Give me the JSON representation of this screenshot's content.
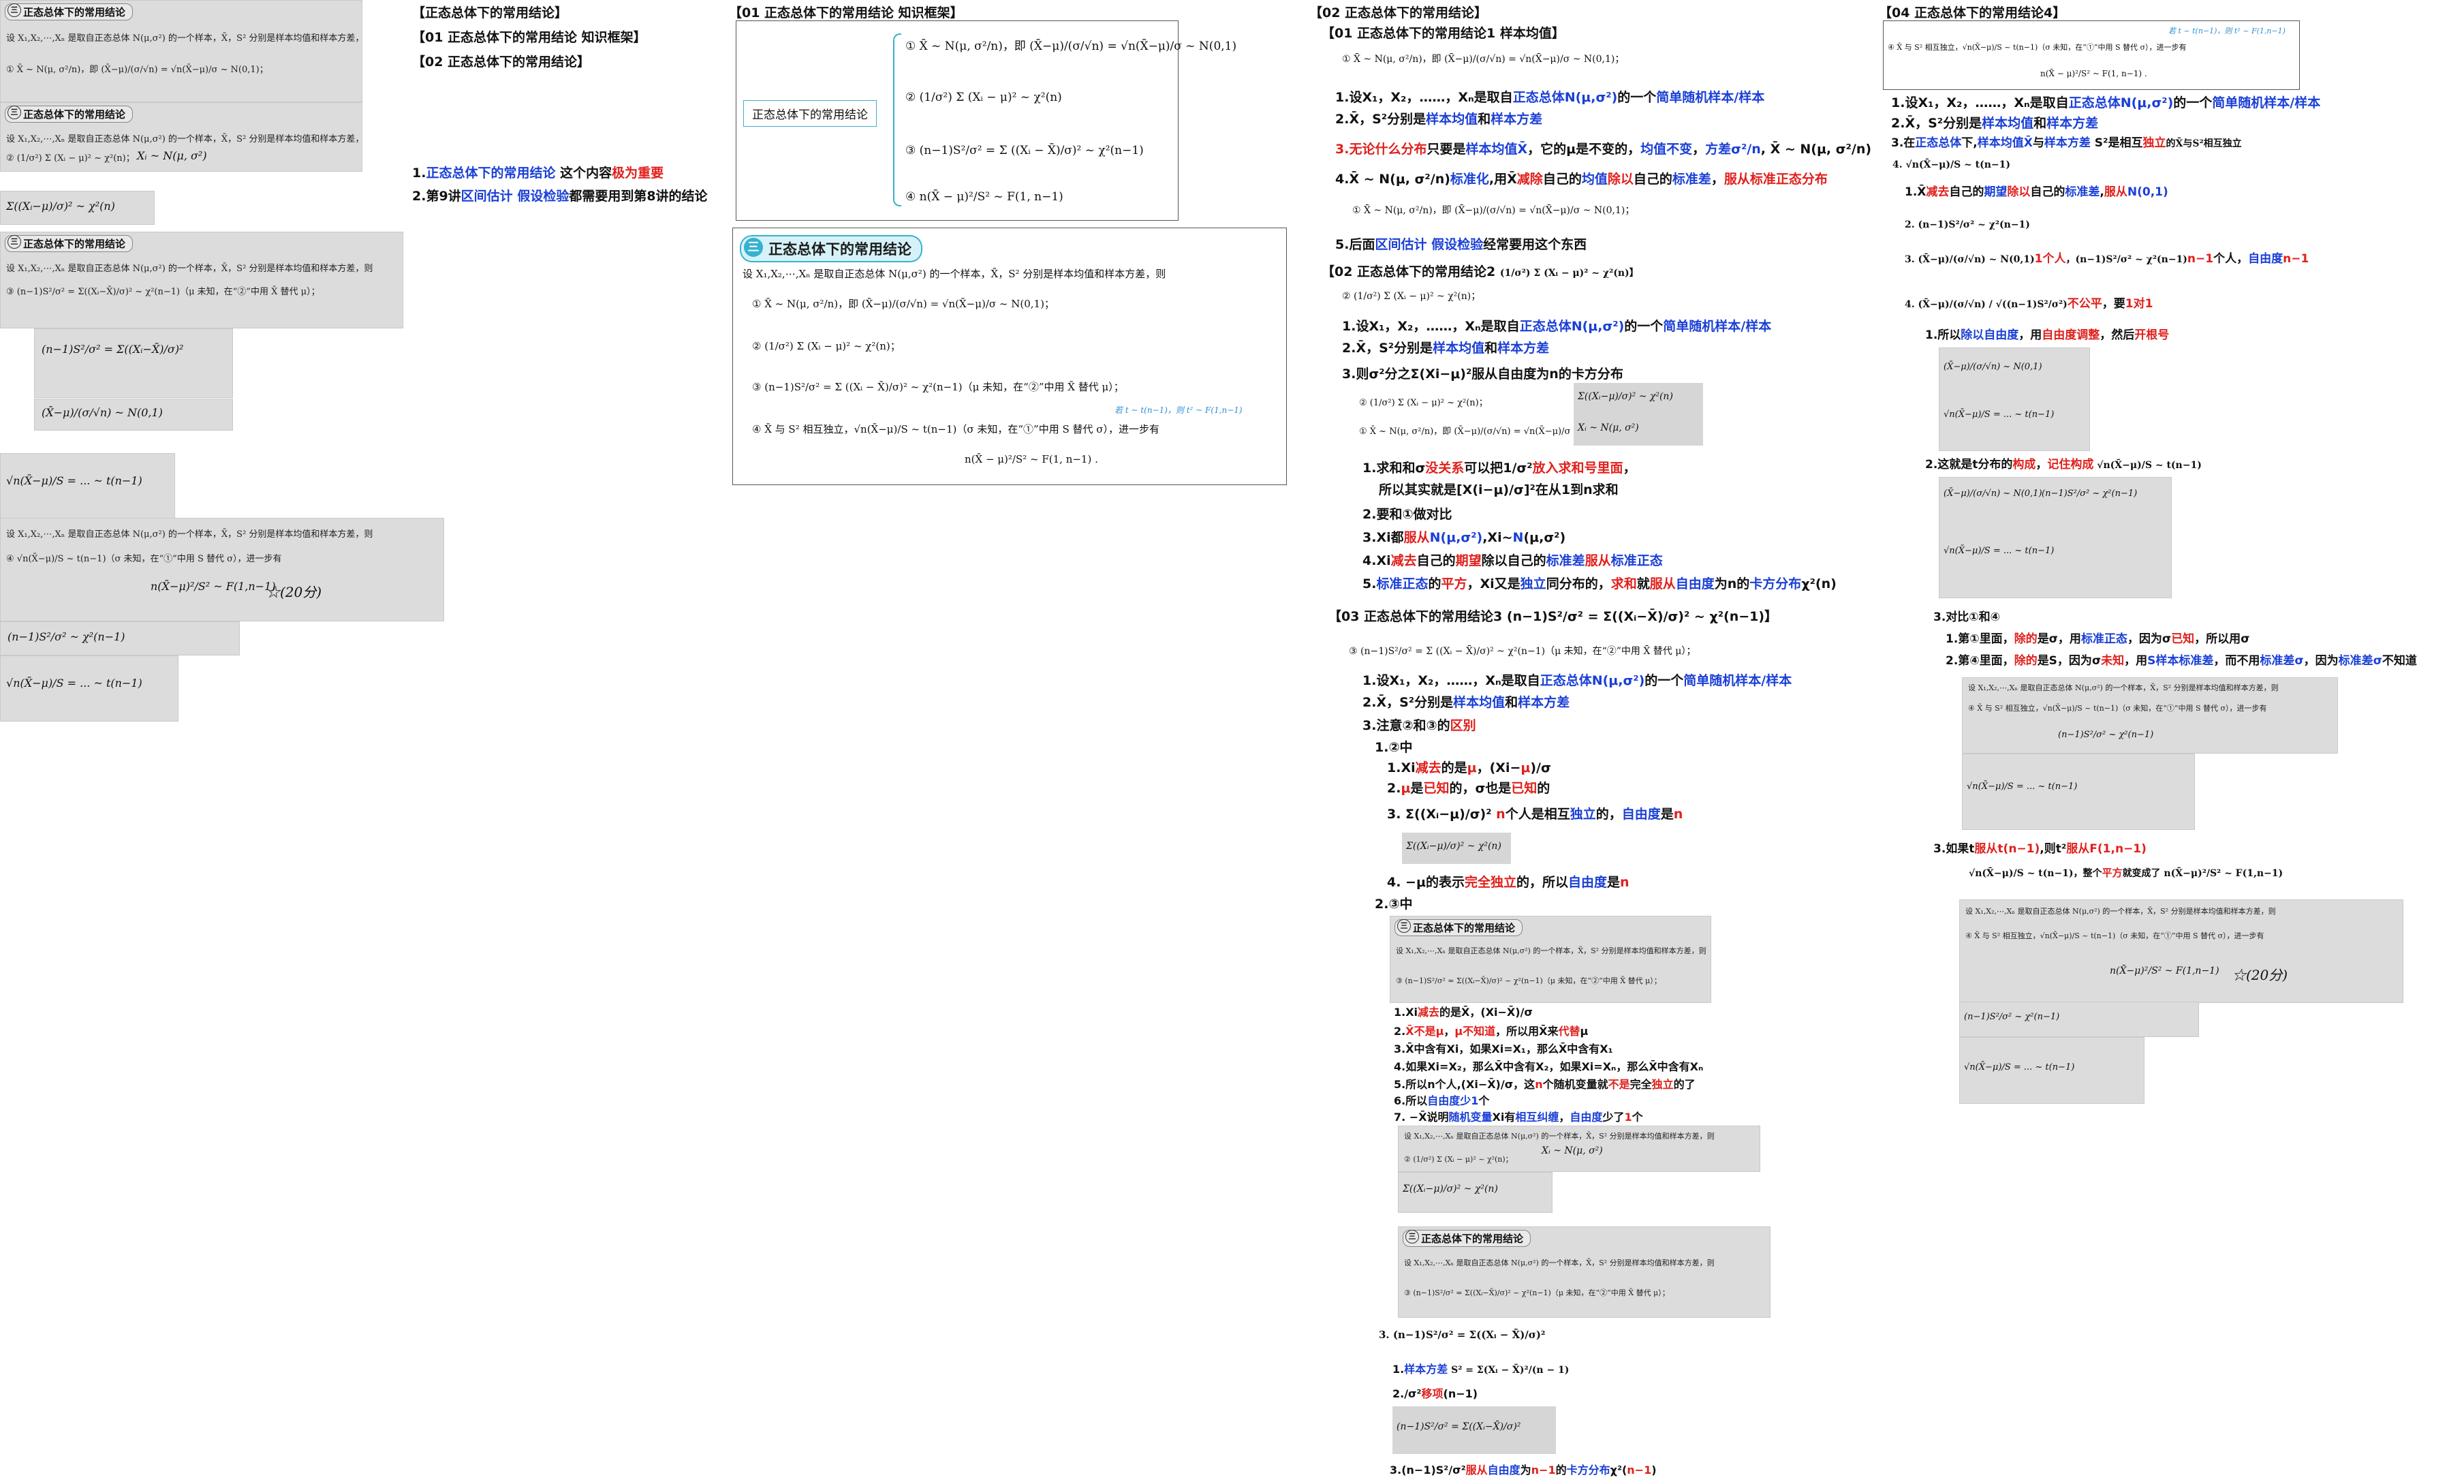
{
  "col1": {
    "header": "【正态总体下的常用结论】",
    "sub1": "【01 正态总体下的常用结论 知识框架】",
    "sub2": "【02 正态总体下的常用结论】",
    "note1_a": "1.",
    "note1_b": "正态总体下的常用结论",
    "note1_c": " 这个内容",
    "note1_d": "极为重要",
    "note2_a": "2.第9讲",
    "note2_b": "区间估计",
    "note2_c": " ",
    "note2_d": "假设检验",
    "note2_e": "都需要用到第8讲的结论"
  },
  "scan_title": "正态总体下的常用结论",
  "frame_col": {
    "header": "【01 正态总体下的常用结论 知识框架】",
    "label": "正态总体下的常用结论",
    "items": [
      "① X̄ ~ N(μ, σ²/n)，即 (X̄−μ)/(σ/√n) = √n(X̄−μ)/σ ~ N(0,1)",
      "② (1/σ²) Σ (Xᵢ − μ)² ~ χ²(n)",
      "③ (n−1)S²/σ² = Σ ((Xᵢ − X̄)/σ)² ~ χ²(n−1)",
      "④ n(X̄ − μ)²/S² ~ F(1, n−1)"
    ],
    "badge_num": "三",
    "badge_text": "正态总体下的常用结论",
    "intro": "设 X₁,X₂,⋯,Xₙ 是取自正态总体 N(μ,σ²) 的一个样本，X̄，S² 分别是样本均值和样本方差，则",
    "r1": "① X̄ ~ N(μ, σ²/n)，即 (X̄−μ)/(σ/√n) = √n(X̄−μ)/σ ~ N(0,1)；",
    "r2": "② (1/σ²) Σ (Xᵢ − μ)² ~ χ²(n)；",
    "r3": "③ (n−1)S²/σ² = Σ ((Xᵢ − X̄)/σ)² ~ χ²(n−1)（μ 未知，在“②”中用 X̄ 替代 μ）；",
    "r4": "④ X̄ 与 S² 相互独立，√n(X̄−μ)/S ~ t(n−1)（σ 未知，在“①”中用 S 替代 σ），进一步有",
    "r4b": "n(X̄ − μ)²/S² ~ F(1, n−1) .",
    "annot": "若 t ~ t(n−1)，则 t² ~ F(1,n−1)"
  },
  "col3": {
    "header": "【02 正态总体下的常用结论】",
    "s1": "【01 正态总体下的常用结论1 样本均值】",
    "s1f": "① X̄ ~ N(μ, σ²/n)，即 (X̄−μ)/(σ/√n) = √n(X̄−μ)/σ ~ N(0,1)；",
    "l1a": "1.设X₁，X₂，……，Xₙ是取自",
    "l1b": "正态总体N(μ,σ²)",
    "l1c": "的一个",
    "l1d": "简单随机样本/样本",
    "l2a": "2.X̄，S²分别是",
    "l2b": "样本均值",
    "l2c": "和",
    "l2d": "样本方差",
    "l3a": "3.无论什么分布",
    "l3b": "只要是",
    "l3c": "样本均值X̄",
    "l3d": "，它的μ是不变的，",
    "l3e": "均值不变",
    "l3f": "，",
    "l3g": "方差σ²/n",
    "l3h": ", X̄ ~ N(μ, σ²/n)",
    "l4a": "4.X̄ ~ N(μ, σ²/n)",
    "l4b": "标准化",
    "l4c": ",用X̄",
    "l4d": "减除",
    "l4e": "自己的",
    "l4f": "均值",
    "l4g": "除以",
    "l4h": "自己的",
    "l4i": "标准差",
    "l4j": "，",
    "l4k": "服从标准正态分布",
    "l4f2": "① X̄ ~ N(μ, σ²/n)，即 (X̄−μ)/(σ/√n) = √n(X̄−μ)/σ ~ N(0,1)；",
    "l5a": "5.后面",
    "l5b": "区间估计",
    "l5c": " ",
    "l5d": "假设检验",
    "l5e": "经常要用这个东西",
    "s2": "【02 正态总体下的常用结论2",
    "s2f": "(1/σ²) Σ (Xᵢ − μ)² ~ χ²(n)】",
    "s2f2": "② (1/σ²) Σ (Xᵢ − μ)² ~ χ²(n)；",
    "m1a": "1.设X₁，X₂，……，Xₙ是取自",
    "m1b": "正态总体N(μ,σ²)",
    "m1c": "的一个",
    "m1d": "简单随机样本/样本",
    "m2a": "2.X̄，S²分别是",
    "m2b": "样本均值",
    "m2c": "和",
    "m2d": "样本方差",
    "m3": "3.则σ²分之Σ(Xi−μ)²服从自由度为n的卡方分布",
    "m3f1": "② (1/σ²) Σ (Xᵢ − μ)² ~ χ²(n)；",
    "m3f2": "① X̄ ~ N(μ, σ²/n)，即 (X̄−μ)/(σ/√n) = √n(X̄−μ)/σ ~ N(0,1)；",
    "hw1": "Σ((Xᵢ−μ)/σ)² ~ χ²(n)",
    "hw2": "Xᵢ ~ N(μ, σ²)",
    "n1a": "1.求和和σ",
    "n1b": "没关系",
    "n1c": "可以把1/σ²",
    "n1d": "放入求和号里面",
    "n1e": "，",
    "n1f": "所以其实就是[X(i−μ)/σ]²在从1到n求和",
    "n2": "2.要和①做对比",
    "n3a": "3.Xi都",
    "n3b": "服从",
    "n3c": "N(μ,σ²)",
    "n3d": ",Xi~",
    "n3e": "N",
    "n3f": "(μ,σ²)",
    "n4a": "4.Xi",
    "n4b": "减去",
    "n4c": "自己的",
    "n4d": "期望",
    "n4e": "除以自己的",
    "n4f": "标准差",
    "n4g": "服从",
    "n4h": "标准正态",
    "n5a": "5.",
    "n5b": "标准正态",
    "n5c": "的",
    "n5d": "平方",
    "n5e": "，Xi又是",
    "n5f": "独立",
    "n5g": "同分布的，",
    "n5h": "求和",
    "n5i": "就",
    "n5j": "服从",
    "n5k": "自由度",
    "n5l": "为n的",
    "n5m": "卡方分布",
    "n5n": "χ²(n)",
    "s3": "【03 正态总体下的常用结论3 (n−1)S²/σ² = Σ((Xᵢ−X̄)/σ)² ~ χ²(n−1)】",
    "s3f": "③ (n−1)S²/σ² = Σ ((Xᵢ − X̄)/σ)² ~ χ²(n−1)（μ 未知，在“②”中用 X̄ 替代 μ）；",
    "p1a": "1.设X₁，X₂，……，Xₙ是取自",
    "p1b": "正态总体N(μ,σ²)",
    "p1c": "的一个",
    "p1d": "简单随机样本/样本",
    "p2a": "2.X̄，S²分别是",
    "p2b": "样本均值",
    "p2c": "和",
    "p2d": "样本方差",
    "p3a": "3.注意②和③的",
    "p3b": "区别",
    "q0": "1.②中",
    "q1a": "1.Xi",
    "q1b": "减去",
    "q1c": "的是",
    "q1d": "μ",
    "q1e": "，(Xi−",
    "q1f": "μ",
    "q1g": ")/σ",
    "q2a": "2.",
    "q2b": "μ",
    "q2c": "是",
    "q2d": "已知",
    "q2e": "的，σ也是",
    "q2f": "已知",
    "q2g": "的",
    "q3a": "3. Σ((Xᵢ−μ)/σ)² ",
    "q3b": "n",
    "q3c": "个人是相互",
    "q3d": "独立",
    "q3e": "的，",
    "q3f": "自由度",
    "q3g": "是",
    "q3h": "n",
    "q3hw": "Σ((Xᵢ−μ)/σ)² ~ χ²(n)",
    "q4a": "4. −μ的表示",
    "q4b": "完全独立",
    "q4c": "的，所以",
    "q4d": "自由度",
    "q4e": "是",
    "q4f": "n",
    "r0": "2.③中",
    "sc1l1": "设 X₁,X₂,⋯,Xₙ 是取自正态总体 N(μ,σ²) 的一个样本，X̄，S² 分别是样本均值和样本方差，则",
    "sc1l2": "③ (n−1)S²/σ² = Σ((Xᵢ−X̄)/σ)² ~ χ²(n−1)（μ 未知，在“②”中用 X̄ 替代 μ）；",
    "t1a": "1.Xi",
    "t1b": "减去",
    "t1c": "的是X̄，(Xi−X̄)/σ",
    "t2a": "2.",
    "t2b": "X̄",
    "t2c": "不是μ",
    "t2d": "，",
    "t2e": "μ不知道",
    "t2f": "，所以用X̄来",
    "t2g": "代替",
    "t2h": "μ",
    "t3": "3.X̄中含有Xi，如果Xi=X₁，那么X̄中含有X₁",
    "t4": "4.如果Xi=X₂，那么X̄中含有X₂，如果Xi=Xₙ，那么X̄中含有Xₙ",
    "t5a": "5.所以n个人,(Xi−X̄)/σ，这",
    "t5b": "n",
    "t5c": "个随机变量就",
    "t5d": "不是",
    "t5e": "完全",
    "t5f": "独立",
    "t5g": "的了",
    "t6a": "6.所以",
    "t6b": "自由度少1",
    "t6c": "个",
    "t7a": "7. −X̄说明",
    "t7b": "随机变量",
    "t7c": "Xi有",
    "t7d": "相互纠缠",
    "t7e": "，",
    "t7f": "自由度",
    "t7g": "少了",
    "t7h": "1",
    "t7i": "个",
    "sc2l1": "设 X₁,X₂,⋯,Xₙ 是取自正态总体 N(μ,σ²) 的一个样本，X̄，S² 分别是样本均值和样本方差，则",
    "sc2l2": "② (1/σ²) Σ (Xᵢ − μ)² ~ χ²(n)；",
    "sc2hw1": "Xᵢ ~ N(μ, σ²)",
    "sc2hw2": "Σ((Xᵢ−μ)/σ)² ~ χ²(n)",
    "sc3l1": "设 X₁,X₂,⋯,Xₙ 是取自正态总体 N(μ,σ²) 的一个样本，X̄，S² 分别是样本均值和样本方差，则",
    "sc3l2": "③ (n−1)S²/σ² = Σ((Xᵢ−X̄)/σ)² ~ χ²(n−1)（μ 未知，在“②”中用 X̄ 替代 μ）；",
    "u3": "3. (n−1)S²/σ² = Σ((Xᵢ − X̄)/σ)²",
    "v1a": "1.",
    "v1b": "样本方差",
    "v1c": " S² = Σ(Xᵢ − X̄)²/(n − 1)",
    "v2a": "2./σ²",
    "v2b": "移项",
    "v2c": "(n−1)",
    "v2hw": "(n−1)S²/σ² = Σ((Xᵢ−X̄)/σ)²",
    "w3a": "3.(n−1)S²/σ²",
    "w3b": "服从",
    "w3c": "自由度",
    "w3d": "为",
    "w3e": "n−1",
    "w3f": "的",
    "w3g": "卡方分布",
    "w3h": "χ²(",
    "w3i": "n−1",
    "w3j": ")"
  },
  "col4": {
    "header": "【04 正态总体下的常用结论4】",
    "box1": "④ X̄ 与 S² 相互独立，√n(X̄−μ)/S ~ t(n−1)（σ 未知，在“①”中用 S 替代 σ），进一步有",
    "box2": "n(X̄ − μ)²/S² ~ F(1, n−1) .",
    "box_annot": "若 t ~ t(n−1)，则 t² ~ F(1,n−1)",
    "a1a": "1.设X₁，X₂，……，Xₙ是取自",
    "a1b": "正态总体N(μ,σ²)",
    "a1c": "的一个",
    "a1d": "简单随机样本/样本",
    "a2a": "2.X̄，S²分别是",
    "a2b": "样本均值",
    "a2c": "和",
    "a2d": "样本方差",
    "a3a": "3.在",
    "a3b": "正态总体",
    "a3c": "下,",
    "a3d": "样本均值X̄",
    "a3e": "与",
    "a3f": "样本方差",
    "a3g": " S²是相互",
    "a3h": "独立",
    "a3i": "的X̄与S²相互独立",
    "a4": "4. √n(X̄−μ)/S ~ t(n−1)",
    "b1a": "1.X̄",
    "b1b": "减去",
    "b1c": "自己的",
    "b1d": "期望",
    "b1e": "除以",
    "b1f": "自己的",
    "b1g": "标准差",
    "b1h": ",",
    "b1i": "服从",
    "b1j": "N(0,1)",
    "b2": "2. (n−1)S²/σ² ~ χ²(n−1)",
    "b3a": "3. (X̄−μ)/(σ/√n) ~ N(0,1)",
    "b3b": "1个人",
    "b3c": "，(n−1)S²/σ² ~ χ²(n−1)",
    "b3d": "n−1",
    "b3e": "个人，",
    "b3f": "自由度",
    "b3g": "n−1",
    "b4a": "4. (X̄−μ)/(σ/√n) / √((n−1)S²/σ²)",
    "b4b": "不公平",
    "b4c": "，要",
    "b4d": "1对1",
    "c1a": "1.所以",
    "c1b": "除以自由度",
    "c1c": "，用",
    "c1d": "自由度调整",
    "c1e": "，然后",
    "c1f": "开根号",
    "c2a": "2.这就是t分布的",
    "c2b": "构成",
    "c2c": "，",
    "c2d": "记住构成",
    "c2e": "  √n(X̄−μ)/S ~ t(n−1)",
    "d3": "3.对比①和④",
    "e1a": "1.第①里面，",
    "e1b": "除的",
    "e1c": "是σ，用",
    "e1d": "标准正态",
    "e1e": "，因为σ",
    "e1f": "已知",
    "e1g": "，所以用σ",
    "e2a": "2.第④里面，",
    "e2b": "除的",
    "e2c": "是S，因为σ",
    "e2d": "未知",
    "e2e": "，用",
    "e2f": "S样本标准差",
    "e2g": "，而不用",
    "e2h": "标准差σ",
    "e2i": "，因为",
    "e2j": "标准差σ",
    "e2k": "不知道",
    "f3a": "3.如果t",
    "f3b": "服从t(n−1)",
    "f3c": ",则t²",
    "f3d": "服从F(1,n−1)",
    "f3e": "√n(X̄−μ)/S ~ t(n−1)，整个",
    "f3f": "平方",
    "f3g": "就变成了 n(X̄−μ)²/S² ~ F(1,n−1)",
    "sc_l1": "设 X₁,X₂,⋯,Xₙ 是取自正态总体 N(μ,σ²) 的一个样本，X̄，S² 分别是样本均值和样本方差，则",
    "sc_l2": "④ X̄ 与 S² 相互独立，√n(X̄−μ)/S ~ t(n−1)（σ 未知，在“①”中用 S 替代 σ），进一步有",
    "sc_l3": "n(X̄−μ)²/S² ~ F(1,n−1)",
    "hw_a": "(X̄−μ)/(σ/√n) ~ N(0,1)",
    "hw_b": "(n−1)S²/σ² ~ χ²(n−1)",
    "hw_c": "√n(X̄−μ)/S = ... ~ t(n−1)",
    "hw_star": "☆(20分)"
  },
  "left_scans": {
    "t1": "设 X₁,X₂,⋯,Xₙ 是取自正态总体 N(μ,σ²) 的一个样本，X̄，S² 分别是样本均值和样本方差，则",
    "f1": "① X̄ ~ N(μ, σ²/n)，即 (X̄−μ)/(σ/√n) = √n(X̄−μ)/σ ~ N(0,1)；",
    "f2": "② (1/σ²) Σ (Xᵢ − μ)² ~ χ²(n)；",
    "f3": "③ (n−1)S²/σ² = Σ((Xᵢ−X̄)/σ)² ~ χ²(n−1)（μ 未知，在“②”中用 X̄ 替代 μ）；",
    "f4": "④ √n(X̄−μ)/S ~ t(n−1)（σ 未知，在“①”中用 S 替代 σ），进一步有",
    "f5": "n(X̄−μ)²/S² ~ F(1,n−1)",
    "hw_x": "Xᵢ ~ N(μ, σ²)",
    "hw_chi": "Σ((Xᵢ−μ)/σ)² ~ χ²(n)",
    "hw_n": "(n−1)S²/σ² = Σ((Xᵢ−X̄)/σ)²",
    "hw_z": "(X̄−μ)/(σ/√n) ~ N(0,1)",
    "hw_c": "(n−1)S²/σ² ~ χ²(n−1)",
    "hw_t": "√n(X̄−μ)/S = ... ~ t(n−1)",
    "hw_star": "☆(20分)"
  }
}
